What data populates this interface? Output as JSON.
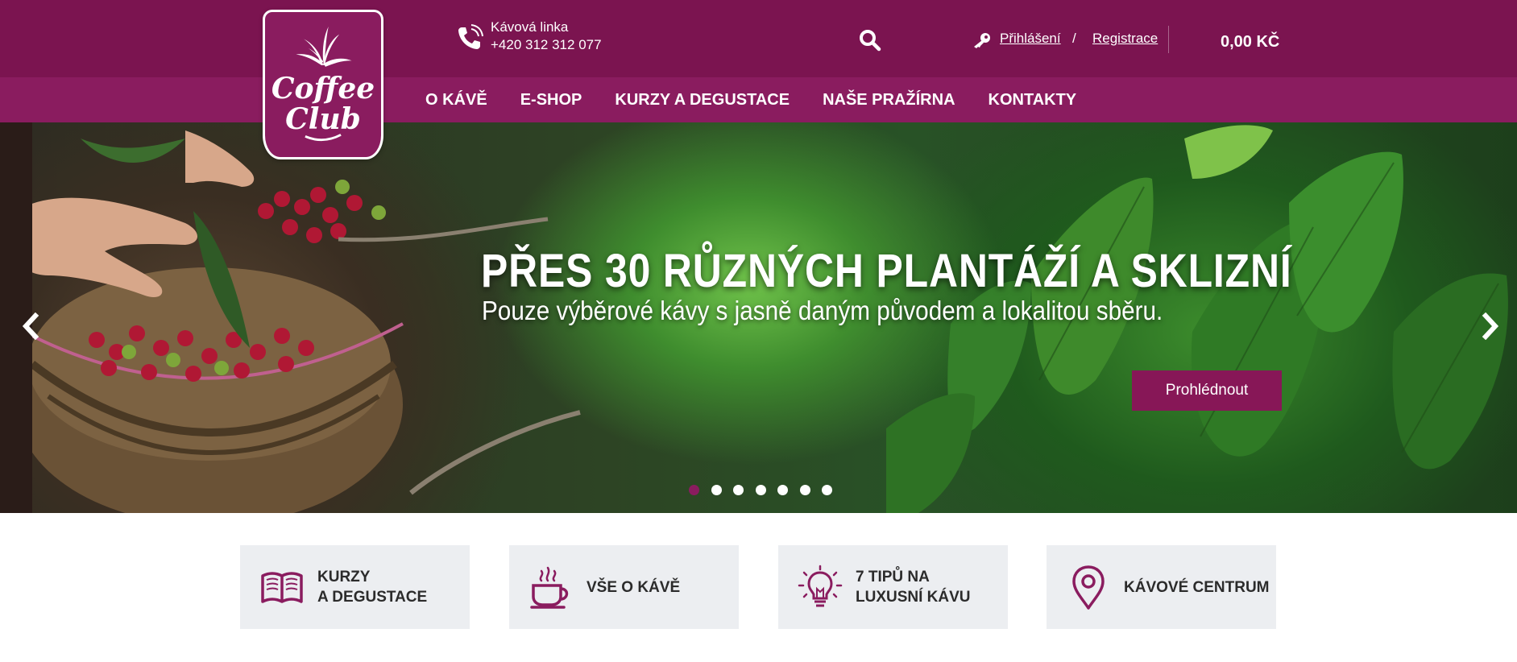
{
  "brand": {
    "logo_line1": "Coffee",
    "logo_line2": "Club",
    "accent": "#7b1450",
    "accent_light": "#8a1c5f"
  },
  "header": {
    "phone_label": "Kávová linka",
    "phone_number": "+420 312 312 077",
    "login": "Přihlášení",
    "separator": "/",
    "register": "Registrace",
    "cart_total": "0,00 KČ"
  },
  "nav": {
    "items": [
      "O KÁVĚ",
      "E-SHOP",
      "KURZY A DEGUSTACE",
      "NAŠE PRAŽÍRNA",
      "KONTAKTY"
    ]
  },
  "hero": {
    "title": "PŘES 30 RŮZNÝCH PLANTÁŽÍ A SKLIZNÍ",
    "subtitle": "Pouze výběrové kávy s jasně daným původem a lokalitou sběru.",
    "button": "Prohlédnout",
    "slide_count": 7,
    "active_slide": 1
  },
  "tiles": [
    {
      "line1": "KURZY",
      "line2": "A DEGUSTACE",
      "icon": "open-book-icon"
    },
    {
      "line1": "VŠE O KÁVĚ",
      "icon": "coffee-cup-icon"
    },
    {
      "line1": "7 TIPŮ NA",
      "line2": "LUXUSNÍ KÁVU",
      "icon": "light-bulb-icon"
    },
    {
      "line1": "KÁVOVÉ CENTRUM",
      "icon": "map-pin-icon"
    }
  ]
}
